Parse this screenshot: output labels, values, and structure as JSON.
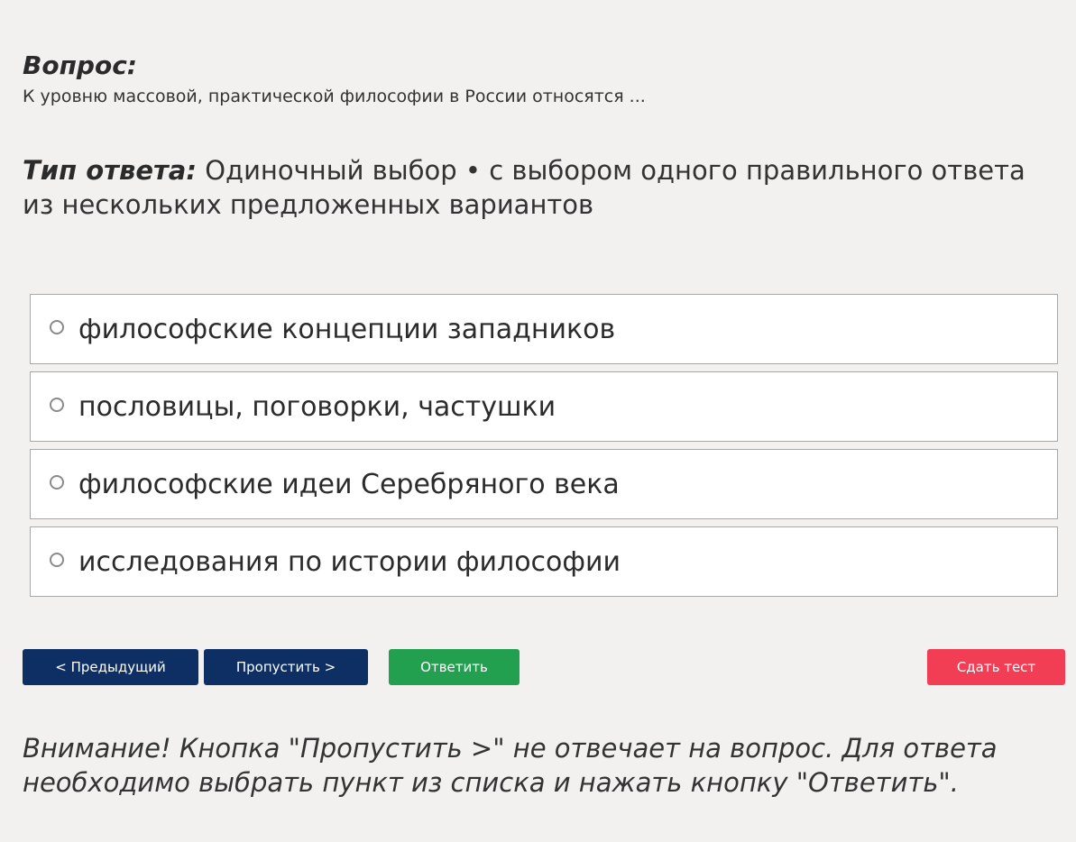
{
  "question": {
    "heading": "Вопрос:",
    "text": "К уровню массовой, практической философии в России относятся ..."
  },
  "answer_type": {
    "label": "Тип ответа:",
    "value": "Одиночный выбор • с выбором одного правильного ответа из нескольких предложенных вариантов"
  },
  "options": [
    {
      "label": "философские концепции западников",
      "selected": false
    },
    {
      "label": "пословицы, поговорки, частушки",
      "selected": false
    },
    {
      "label": "философские идеи Серебряного века",
      "selected": false
    },
    {
      "label": "исследования по истории философии",
      "selected": false
    }
  ],
  "buttons": {
    "previous": "< Предыдущий",
    "skip": "Пропустить >",
    "answer": "Ответить",
    "submit": "Сдать тест"
  },
  "colors": {
    "nav_button": "#0d2f63",
    "answer_button": "#23a04f",
    "submit_button": "#f13e54",
    "background": "#f2f1ef"
  },
  "warning": "Внимание! Кнопка \"Пропустить >\" не отвечает на вопрос. Для ответа необходимо выбрать пункт из списка и нажать кнопку \"Ответить\"."
}
